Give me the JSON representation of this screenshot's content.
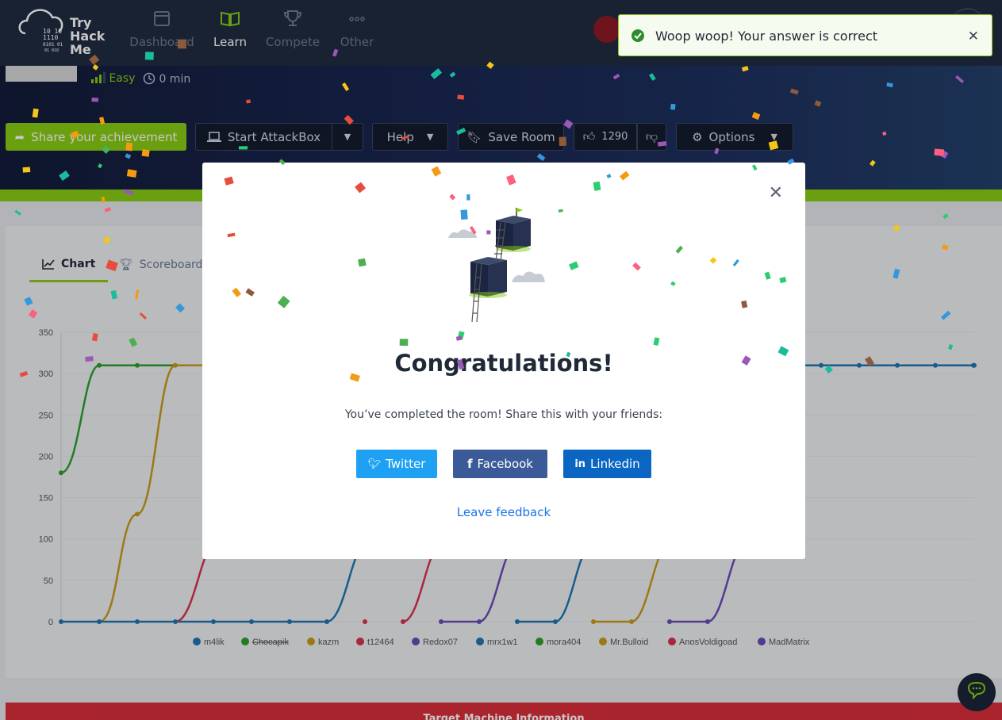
{
  "navbar": {
    "logo_lines": [
      "Try",
      "Hack",
      "Me"
    ],
    "items": [
      {
        "label": "Dashboard",
        "icon": "calendar-icon",
        "active": false
      },
      {
        "label": "Learn",
        "icon": "book-icon",
        "active": true
      },
      {
        "label": "Compete",
        "icon": "trophy-icon",
        "active": false
      },
      {
        "label": "Other",
        "icon": "dots-icon",
        "active": false
      }
    ]
  },
  "room": {
    "difficulty": "Easy",
    "duration": "0 min"
  },
  "actions": {
    "share": "Share your achievement",
    "attackbox": "Start AttackBox",
    "help": "Help",
    "save": "Save Room",
    "likes": "1290",
    "options": "Options"
  },
  "tabs": [
    {
      "label": "Chart",
      "icon": "chart-icon",
      "active": true
    },
    {
      "label": "Scoreboard",
      "icon": "trophy-icon",
      "active": false
    }
  ],
  "chart_data": {
    "type": "line",
    "y_ticks": [
      "0",
      "50",
      "100",
      "150",
      "200",
      "250",
      "300",
      "350"
    ],
    "ylim": [
      0,
      350
    ],
    "series": [
      {
        "name": "m4lik",
        "color": "#1f77b4",
        "hidden": false
      },
      {
        "name": "Chocapik",
        "color": "#2ca02c",
        "hidden": true
      },
      {
        "name": "kazm",
        "color": "#c99a1a",
        "hidden": false
      },
      {
        "name": "t12464",
        "color": "#d9334f",
        "hidden": false
      },
      {
        "name": "Redox07",
        "color": "#6b4bb8",
        "hidden": false
      },
      {
        "name": "mrx1w1",
        "color": "#1f77b4",
        "hidden": false
      },
      {
        "name": "mora404",
        "color": "#2ca02c",
        "hidden": false
      },
      {
        "name": "Mr.Bulloid",
        "color": "#c99a1a",
        "hidden": false
      },
      {
        "name": "AnosVoldigoad",
        "color": "#d9334f",
        "hidden": false
      },
      {
        "name": "MadMatrix",
        "color": "#6b4bb8",
        "hidden": false
      }
    ],
    "visible_points": {
      "green": {
        "values": [
          180,
          310,
          310
        ]
      },
      "orange": {
        "values": [
          0,
          130,
          310,
          310
        ]
      },
      "blue_tail": {
        "values": [
          310,
          310,
          310,
          310,
          310
        ]
      }
    }
  },
  "modal": {
    "title": "Congratulations!",
    "text": "You’ve completed the room! Share this with your friends:",
    "twitter": "Twitter",
    "facebook": "Facebook",
    "linkedin": "Linkedin",
    "feedback": "Leave feedback"
  },
  "toast": {
    "message": "Woop woop! Your answer is correct"
  },
  "target": {
    "label": "Target Machine Information"
  }
}
